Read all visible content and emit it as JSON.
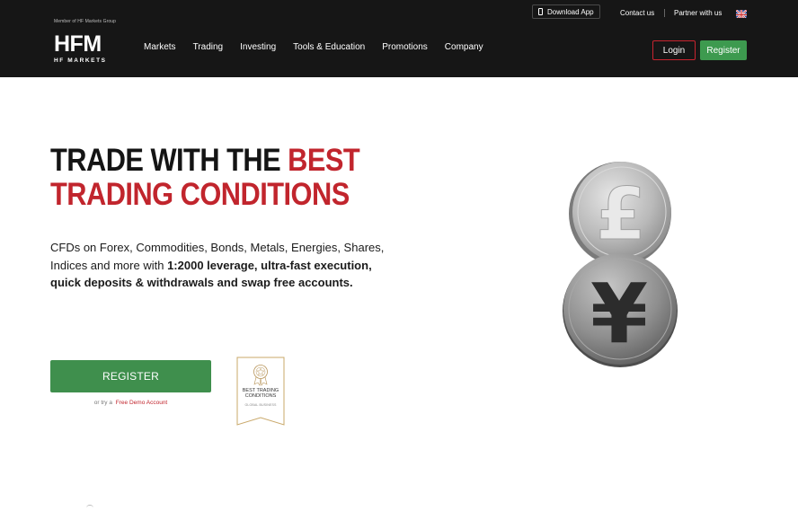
{
  "header": {
    "member_text": "Member of HF Markets Group",
    "logo_mark": "HFM",
    "logo_sub": "HF MARKETS",
    "nav": [
      {
        "label": "Markets"
      },
      {
        "label": "Trading"
      },
      {
        "label": "Investing"
      },
      {
        "label": "Tools & Education"
      },
      {
        "label": "Promotions"
      },
      {
        "label": "Company"
      }
    ],
    "download_app": "Download App",
    "contact": "Contact us",
    "partner": "Partner with us",
    "login": "Login",
    "register": "Register",
    "language_icon": "uk-flag-icon"
  },
  "hero": {
    "title_part1": "TRADE WITH THE ",
    "title_part2": "BEST",
    "title_part3": "TRADING CONDITIONS",
    "desc_plain": "CFDs on Forex, Commodities, Bonds, Metals, Energies, Shares, Indices and more with ",
    "desc_bold": "1:2000 leverage, ultra-fast execution, quick deposits & withdrawals and swap free accounts.",
    "cta": "REGISTER",
    "demo_prefix": "or try a",
    "demo_link": "Free Demo Account",
    "award_title": "BEST TRADING CONDITIONS",
    "award_sub": "GLOBAL BUSINESS"
  },
  "colors": {
    "header_bg": "#161616",
    "accent_red": "#c1252d",
    "accent_green": "#3f8f4d"
  }
}
